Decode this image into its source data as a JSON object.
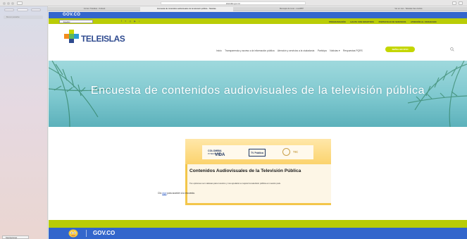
{
  "browser": {
    "address": "teleislas.gov.co",
    "tabs": [
      "Correo: Teleislas - Outlook",
      "Encuesta de contenidos audiovisuales de la televisión pública - Teleislas",
      "Mensajes de texto - LiveWPP",
      "Ver en vivo - Teleislas San Andrés"
    ]
  },
  "sidebar": {
    "search_placeholder": "Buscar pestañas",
    "footer_label": "Suscripciones"
  },
  "gov_bar": {
    "logo": "GOV.CO"
  },
  "top_bar": {
    "language": "Español",
    "links": [
      "PROGRAMACIÓN",
      "HAGTA CON NOSOTROS",
      "PORTAFOLIO DE SERVICIOS",
      "ATENCIÓN AL CIUDADANO"
    ]
  },
  "header": {
    "brand": "TELEISLAS",
    "nav": [
      "Inicio",
      "Transparencia y acceso a la información pública",
      "Atención y servicios a la ciudadanía",
      "Participa",
      "Noticias ▾",
      "Respuestas PQRS"
    ],
    "cta": "SEÑAL EN VIVO"
  },
  "hero": {
    "title": "Encuesta de contenidos audiovisuales de la televisión pública"
  },
  "card": {
    "logo_colombia_top": "COLOMBIA",
    "logo_colombia_sub": "POTENCIA DE LA",
    "logo_vida": "VIDA",
    "logo_tvp": "TV Pública",
    "logo_tic": "TIC",
    "title": "Contenidos Audiovisuales de la Televisión Pública",
    "description": "Tus opiniones son valiosas para nosotros y nos ayudarán a mejorar la televisión pública en nuestro país."
  },
  "click_line": {
    "prefix": "Clic ",
    "link": "aquí",
    "suffix": " para acceder a la encuesta."
  },
  "footer": {
    "logo": "GOV.CO"
  }
}
